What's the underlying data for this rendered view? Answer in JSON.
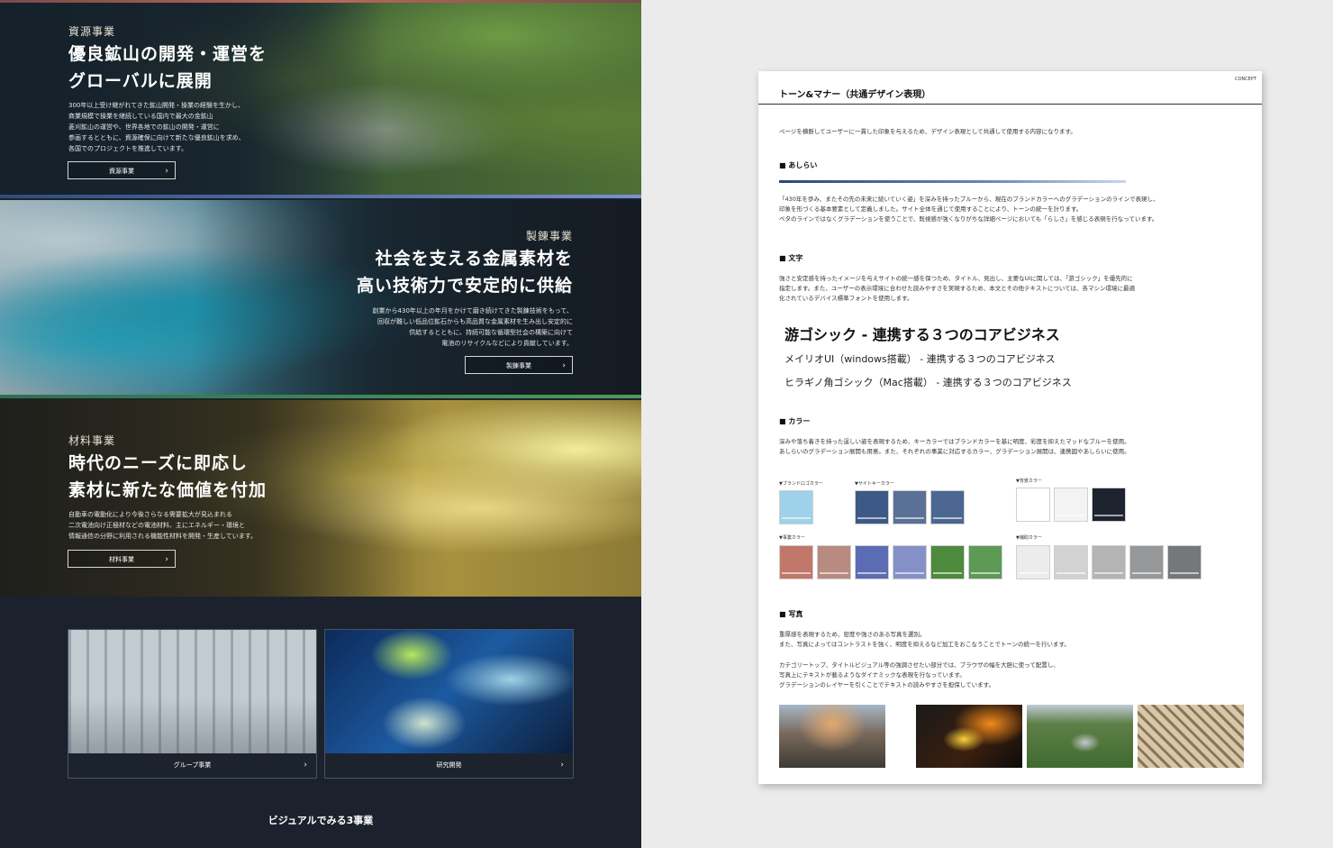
{
  "site": {
    "resources": {
      "category": "資源事業",
      "headline": [
        "優良鉱山の開発・運営を",
        "グローバルに展開"
      ],
      "body": [
        "300年以上受け継がれてきた鉱山開発・操業の経験を生かし、",
        "商業規模で操業を継続している国内で最大の金鉱山",
        "菱刈鉱山の運営や、世界各地での鉱山の開発・運営に",
        "参画するとともに、資源確保に向けて新たな優良鉱山を求め、",
        "各国でのプロジェクトを推進しています。"
      ],
      "button": "資源事業"
    },
    "smelting": {
      "category": "製錬事業",
      "headline": [
        "社会を支える金属素材を",
        "高い技術力で安定的に供給"
      ],
      "body": [
        "創業から430年以上の年月をかけて磨き続けてきた製錬技術をもって、",
        "回収が難しい低品位鉱石からも高品質な金属素材を生み出し安定的に",
        "供給するとともに、持続可能な循環型社会の構築に向けて",
        "電池のリサイクルなどにより貢献しています。"
      ],
      "button": "製錬事業"
    },
    "materials": {
      "category": "材料事業",
      "headline": [
        "時代のニーズに即応し",
        "素材に新たな価値を付加"
      ],
      "body": [
        "自動車の電動化により今後さらなる需要拡大が見込まれる",
        "二次電池向け正極材などの電池材料、主にエネルギー・環境と",
        "情報通信の分野に利用される機能性材料を開発・生産しています。"
      ],
      "button": "材料事業"
    },
    "tiles": [
      "グループ事業",
      "研究開発"
    ],
    "footer_title": "ビジュアルでみる3事業",
    "chevron": "›"
  },
  "doc": {
    "tag": "CONCEPT",
    "title": "トーン&マナー（共通デザイン表現）",
    "intro": "ページを横断してユーザーに一貫した印象を与えるため、デザイン表現として共通して使用する内容になります。",
    "shitsurai": {
      "heading": "■ あしらい",
      "body": [
        "「430年を歩み、またその先の未来に続いていく姿」を深みを持ったブルーから、現在のブランドカラーへのグラデーションのラインで表現し、",
        "印象を形づくる基本要素として定義しました。サイト全体を通じて使用することにより、トーンの統一を計ります。",
        "ベタのラインではなくグラデーションを使うことで、既視感が強くなりがちな詳細ページにおいても「らしさ」を感じる表現を行なっています。"
      ]
    },
    "moji": {
      "heading": "■ 文字",
      "body": [
        "強さと安定感を持ったイメージを与えサイトの統一感を保つため、タイトル、見出し、主要なUIに関しては、「游ゴシック」を優先的に",
        "指定します。また、ユーザーの表示環境に合わせた読みやすさを実現するため、本文とその他テキストについては、各マシン環境に最適",
        "化されているデバイス標準フォントを使用します。"
      ],
      "sample_1": "游ゴシック - 連携する３つのコアビジネス",
      "sample_2": "メイリオUI（windows搭載） - 連携する３つのコアビジネス",
      "sample_3": "ヒラギノ角ゴシック（Mac搭載） - 連携する３つのコアビジネス"
    },
    "color": {
      "heading": "■ カラー",
      "body": [
        "深みや落ち着きを持った逞しい姿を表現するため、キーカラーではブランドカラーを基に明度、彩度を抑えたマッドなブルーを使用。",
        "あしらいのグラデーション展開も用意。また、それぞれの事業に対応するカラー、グラデーション展開は、連携図やあしらいに使用。"
      ],
      "groups": [
        {
          "label": "▼ブランドロゴカラー",
          "swatches": [
            "#9fd1ea"
          ]
        },
        {
          "label": "▼サイトキーカラー",
          "swatches": [
            "#3d5a86",
            "#5a7096",
            "#4b6791"
          ]
        },
        {
          "label": "▼背景カラー",
          "swatches": [
            "#ffffff",
            "#f3f3f3",
            "#1d2430"
          ]
        },
        {
          "label": "▼事業カラー",
          "swatches": [
            "#c1776a",
            "#b88a80",
            "#5b6cb4",
            "#8690c8",
            "#4d8a3c",
            "#5c9a56"
          ]
        },
        {
          "label": "▼補助カラー",
          "swatches": [
            "#ececec",
            "#d2d2d2",
            "#b4b4b4",
            "#97989a",
            "#76777a"
          ]
        }
      ]
    },
    "photo": {
      "heading": "■ 写真",
      "body_1": [
        "重厚感を表現するため、密度や強さのある写真を選別。",
        "また、写真によってはコントラストを強く、明度を抑えるなど加工をおこなうことでトーンの統一を行います。"
      ],
      "body_2": [
        "カテゴリートップ、タイトルビジュアル等の強調させたい部分では、ブラウザの幅を大胆に使って配置し、",
        "写真上にテキストが載るようなダイナミックな表現を行なっています。",
        "グラデーションのレイヤーを引くことでテキストの読みやすさを担保しています。"
      ]
    }
  }
}
